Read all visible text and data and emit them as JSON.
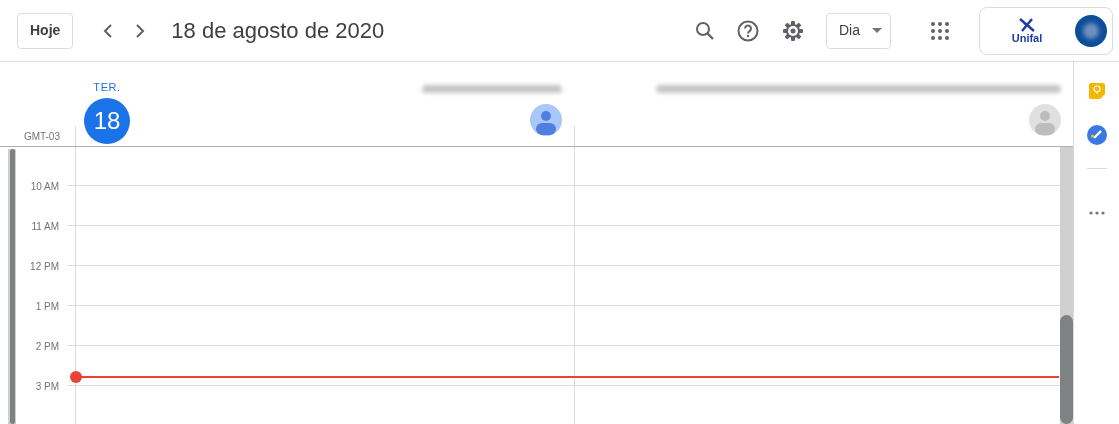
{
  "toolbar": {
    "today_button": "Hoje",
    "date_title": "18 de agosto de 2020",
    "view_select": "Dia"
  },
  "account": {
    "org_logo_text": "Unifal"
  },
  "day_header": {
    "weekday": "TER.",
    "day": "18",
    "today": true
  },
  "timezone": "GMT-03",
  "calendars": [
    {
      "color": "#a8c7fa"
    },
    {
      "color": "#e0e0e0"
    }
  ],
  "hours": [
    "10 AM",
    "11 AM",
    "12 PM",
    "1 PM",
    "2 PM",
    "3 PM"
  ]
}
